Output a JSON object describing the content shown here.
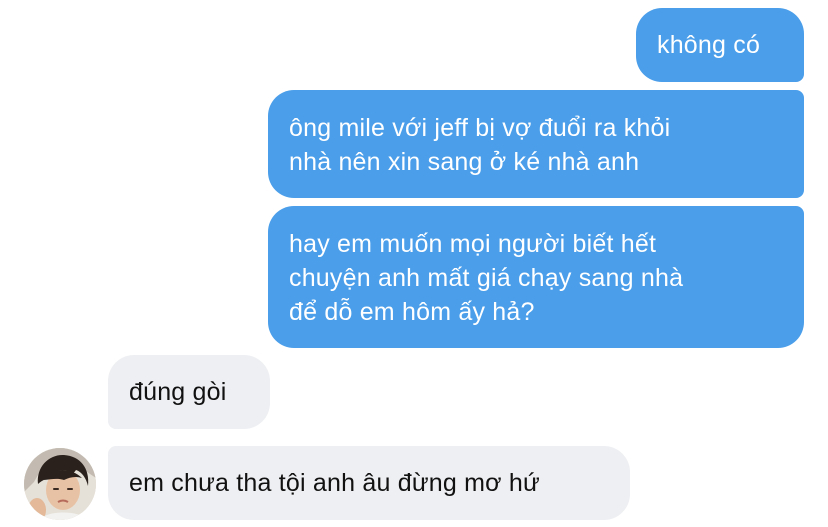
{
  "messages": [
    {
      "side": "outgoing",
      "lines": [
        "không có"
      ]
    },
    {
      "side": "outgoing",
      "lines": [
        "ông mile với jeff bị vợ đuổi ra khỏi",
        "nhà nên xin sang ở ké nhà anh"
      ]
    },
    {
      "side": "outgoing",
      "lines": [
        "hay em muốn mọi người biết hết",
        "chuyện anh mất giá chạy sang nhà",
        "để dỗ em hôm ấy hả?"
      ]
    },
    {
      "side": "incoming",
      "lines": [
        "đúng gòi"
      ]
    },
    {
      "side": "incoming",
      "lines": [
        "em chưa tha tội anh âu đừng mơ hứ"
      ]
    }
  ],
  "avatar": {
    "icon": "contact-avatar-photo"
  },
  "colors": {
    "outgoing_bubble": "#4a9eea",
    "incoming_bubble": "#eeeff2",
    "outgoing_text": "#ffffff",
    "incoming_text": "#111111",
    "background": "#ffffff"
  }
}
